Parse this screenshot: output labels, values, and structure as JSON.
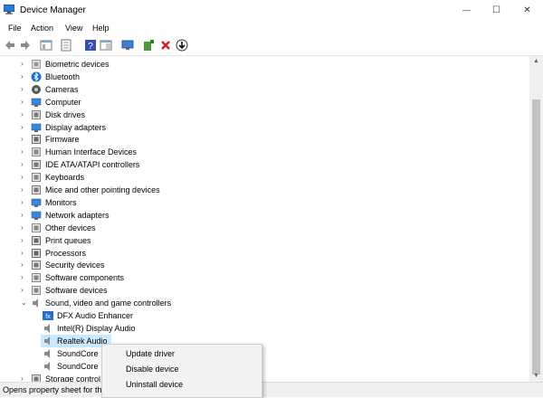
{
  "window": {
    "title": "Device Manager",
    "controls": {
      "minimize": "—",
      "maximize": "☐",
      "close": "✕"
    }
  },
  "menu": [
    "File",
    "Action",
    "View",
    "Help"
  ],
  "toolbar": [
    "back-arrow-icon",
    "forward-arrow-icon",
    "show-hide-tree-icon",
    "properties-icon",
    "help-icon",
    "console-tree-icon",
    "monitor-scan-icon",
    "add-driver-icon",
    "uninstall-x-icon",
    "update-driver-icon"
  ],
  "tree": {
    "categories": [
      {
        "label": "Biometric devices",
        "icon": "biometric-icon",
        "expanded": false
      },
      {
        "label": "Bluetooth",
        "icon": "bluetooth-icon",
        "expanded": false
      },
      {
        "label": "Cameras",
        "icon": "camera-icon",
        "expanded": false
      },
      {
        "label": "Computer",
        "icon": "computer-icon",
        "expanded": false
      },
      {
        "label": "Disk drives",
        "icon": "disk-drive-icon",
        "expanded": false
      },
      {
        "label": "Display adapters",
        "icon": "display-adapter-icon",
        "expanded": false
      },
      {
        "label": "Firmware",
        "icon": "firmware-icon",
        "expanded": false
      },
      {
        "label": "Human Interface Devices",
        "icon": "hid-icon",
        "expanded": false
      },
      {
        "label": "IDE ATA/ATAPI controllers",
        "icon": "ide-controller-icon",
        "expanded": false
      },
      {
        "label": "Keyboards",
        "icon": "keyboard-icon",
        "expanded": false
      },
      {
        "label": "Mice and other pointing devices",
        "icon": "mouse-icon",
        "expanded": false
      },
      {
        "label": "Monitors",
        "icon": "monitor-icon",
        "expanded": false
      },
      {
        "label": "Network adapters",
        "icon": "network-adapter-icon",
        "expanded": false
      },
      {
        "label": "Other devices",
        "icon": "other-devices-icon",
        "expanded": false
      },
      {
        "label": "Print queues",
        "icon": "printer-icon",
        "expanded": false
      },
      {
        "label": "Processors",
        "icon": "processor-icon",
        "expanded": false
      },
      {
        "label": "Security devices",
        "icon": "security-device-icon",
        "expanded": false
      },
      {
        "label": "Software components",
        "icon": "software-component-icon",
        "expanded": false
      },
      {
        "label": "Software devices",
        "icon": "software-device-icon",
        "expanded": false
      },
      {
        "label": "Sound, video and game controllers",
        "icon": "speaker-icon",
        "expanded": true
      }
    ],
    "sound_children": [
      {
        "label": "DFX Audio Enhancer",
        "icon": "dfx-icon",
        "selected": false
      },
      {
        "label": "Intel(R) Display Audio",
        "icon": "speaker-icon",
        "selected": false
      },
      {
        "label": "Realtek Audio",
        "icon": "speaker-icon",
        "selected": true
      },
      {
        "label": "SoundCore",
        "icon": "speaker-icon",
        "selected": false
      },
      {
        "label": "SoundCore",
        "icon": "speaker-icon",
        "selected": false
      }
    ],
    "after": [
      {
        "label": "Storage control",
        "icon": "storage-icon",
        "expanded": false
      }
    ]
  },
  "context_menu": [
    "Update driver",
    "Disable device",
    "Uninstall device"
  ],
  "status": "Opens property sheet for th",
  "colors": {
    "selection": "#cce8ff",
    "menu_bg": "#f2f2f2",
    "status_bg": "#f0f0f0"
  }
}
